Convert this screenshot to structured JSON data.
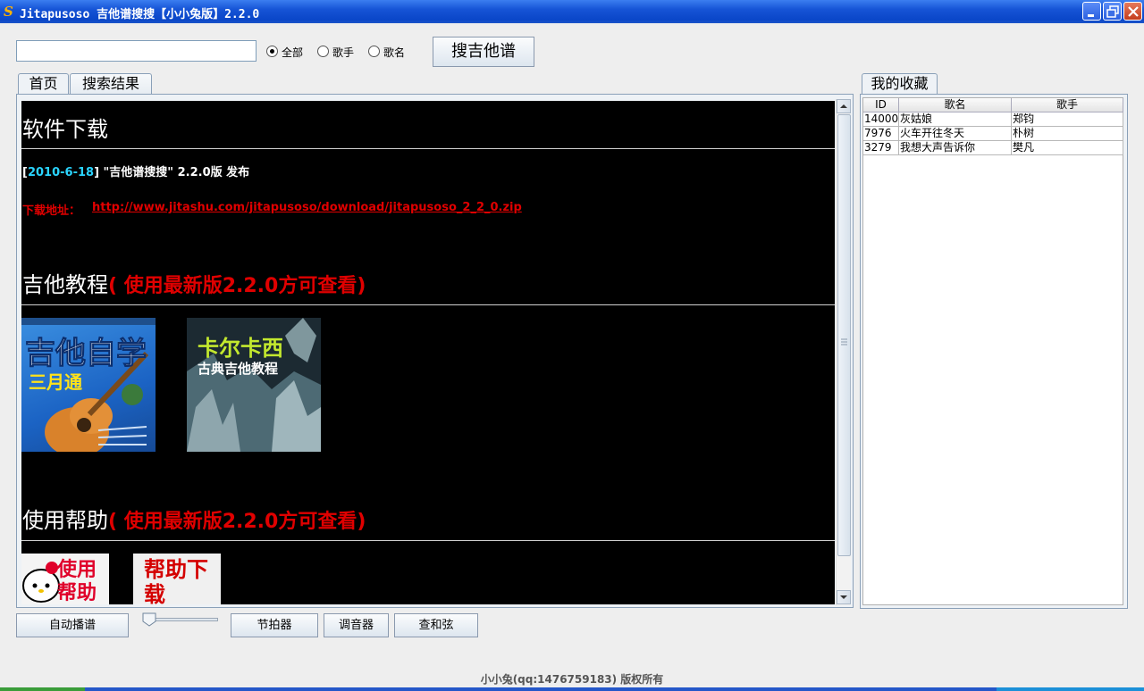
{
  "window": {
    "title": "Jitapusoso 吉他谱搜搜【小小兔版】2.2.0",
    "icon": "app-logo-s-icon",
    "controls": [
      "minimize-icon",
      "maximize-icon",
      "close-icon"
    ]
  },
  "search": {
    "value": "",
    "placeholder": "",
    "options": [
      {
        "label": "全部",
        "selected": true
      },
      {
        "label": "歌手",
        "selected": false
      },
      {
        "label": "歌名",
        "selected": false
      }
    ],
    "button_label": "搜吉他谱"
  },
  "tabs": [
    {
      "label": "首页",
      "active": true
    },
    {
      "label": "搜索结果",
      "active": false
    }
  ],
  "home": {
    "download_section": {
      "heading": "软件下载",
      "news_bracket_open": "[",
      "news_date": "2010-6-18",
      "news_text": "] \"吉他谱搜搜\" 2.2.0版 发布",
      "download_label": "下载地址：",
      "download_url": "http://www.jitashu.com/jitapusoso/download/jitapusoso_2_2_0.zip"
    },
    "tutorial_section": {
      "heading": "吉他教程",
      "note": "( 使用最新版2.2.0方可查看)",
      "covers": [
        {
          "title": "吉他自学",
          "subtitle": "三月通"
        },
        {
          "title": "卡尔卡西",
          "subtitle": "古典吉他教程"
        }
      ]
    },
    "help_section": {
      "heading": "使用帮助",
      "note": "( 使用最新版2.2.0方可查看)",
      "covers": [
        {
          "title": "使用帮助"
        },
        {
          "title": "帮助下载"
        }
      ]
    }
  },
  "favorites": {
    "tab_label": "我的收藏",
    "columns": [
      "ID",
      "歌名",
      "歌手"
    ],
    "rows": [
      [
        "14000",
        "灰姑娘",
        "郑钧"
      ],
      [
        "7976",
        "火车开往冬天",
        "朴树"
      ],
      [
        "3279",
        "我想大声告诉你",
        "樊凡"
      ]
    ]
  },
  "controls": {
    "autoplay_label": "自动播谱",
    "speed_level": 0.1,
    "metronome_label": "节拍器",
    "tuner_label": "调音器",
    "chord_label": "查和弦"
  },
  "footer": {
    "copyright": "小小兔(qq:1476759183) 版权所有"
  },
  "colors": {
    "title_bar": "#0a46c8",
    "content_bg": "#000000",
    "accent_red": "#e00000",
    "date_cyan": "#2ad4ff"
  }
}
